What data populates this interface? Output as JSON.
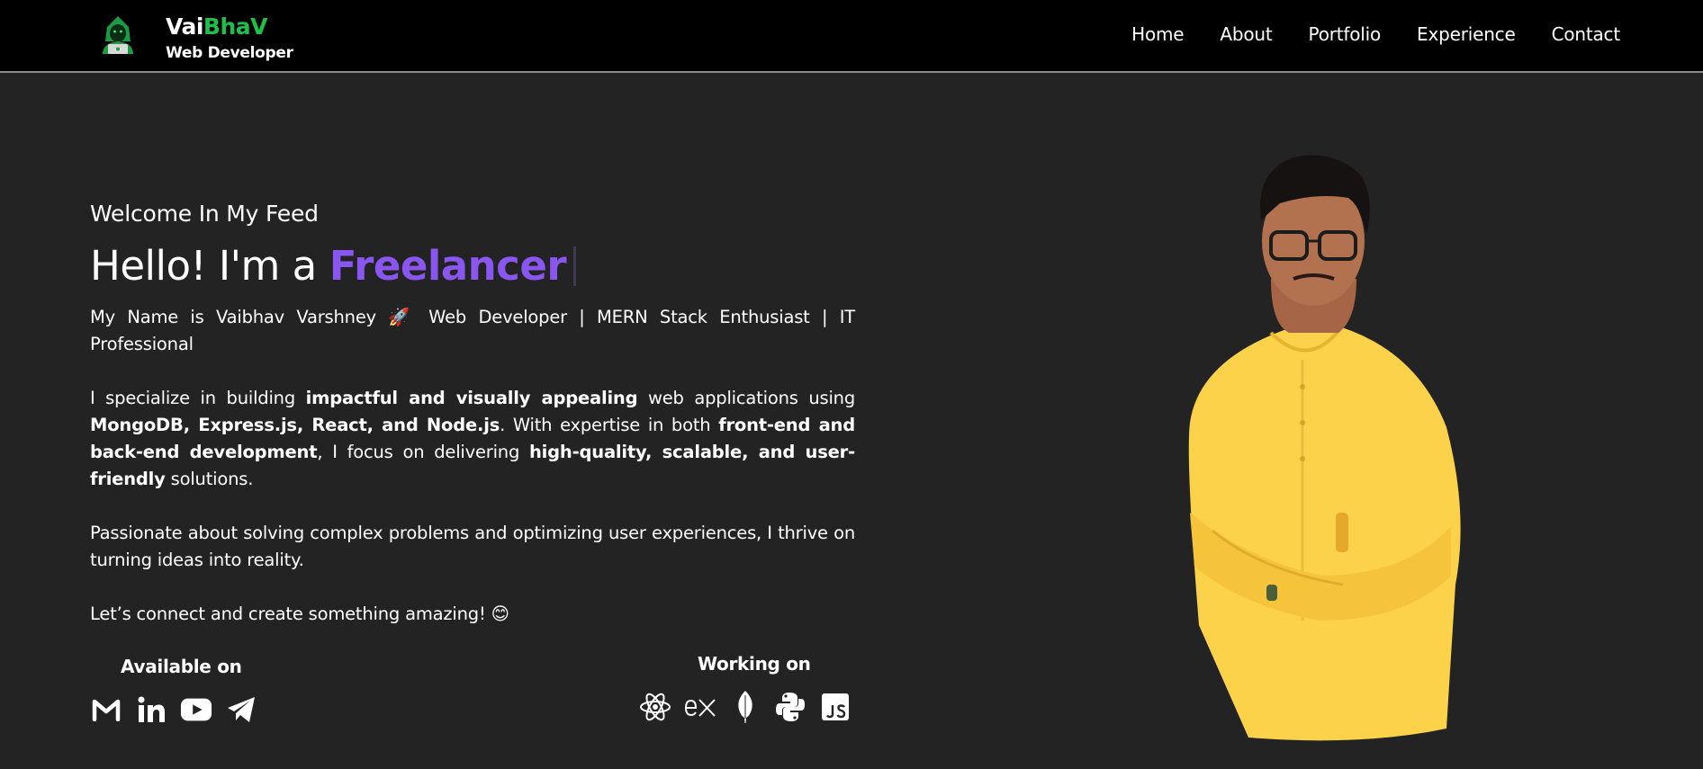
{
  "brand": {
    "name_first": "Vai",
    "name_accent": "BhaV",
    "role": "Web Developer"
  },
  "nav": [
    {
      "label": "Home"
    },
    {
      "label": "About"
    },
    {
      "label": "Portfolio"
    },
    {
      "label": "Experience"
    },
    {
      "label": "Contact"
    }
  ],
  "hero": {
    "welcome": "Welcome In My Feed",
    "greeting": "Hello! I'm a",
    "role": "Freelancer",
    "intro_name": "My Name is Vaibhav Varshney",
    "intro_emoji": "🚀",
    "intro_rest": "Web Developer | MERN Stack Enthusiast | IT Professional",
    "p2": {
      "t1": "I specialize in building ",
      "b1": "impactful and visually appealing",
      "t2": " web applications using ",
      "b2": "MongoDB, Express.js, React, and Node.js",
      "t3": ". With expertise in both ",
      "b3": "front-end and back-end development",
      "t4": ", I focus on delivering ",
      "b4": "high-quality, scalable, and user-friendly",
      "t5": " solutions."
    },
    "p3": "Passionate about solving complex problems and optimizing user experiences, I thrive on turning ideas into reality.",
    "p4": "Let’s connect and create something amazing!",
    "p4_emoji": "😊"
  },
  "available": {
    "title": "Available on",
    "icons": [
      "gmail-icon",
      "linkedin-icon",
      "youtube-icon",
      "telegram-icon"
    ]
  },
  "working": {
    "title": "Working on",
    "icons": [
      "react-icon",
      "express-icon",
      "mongodb-icon",
      "python-icon",
      "javascript-icon"
    ]
  },
  "colors": {
    "accent_green": "#1fbf4a",
    "accent_purple": "#8a56f0",
    "background": "#242324",
    "navbar": "#000000",
    "shirt": "#fbd24a"
  }
}
